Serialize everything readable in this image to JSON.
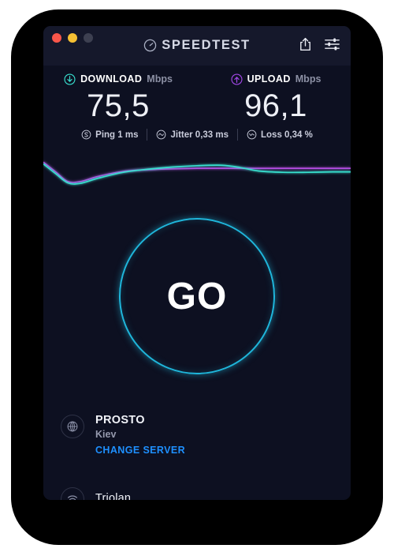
{
  "window": {
    "traffic_lights": [
      {
        "name": "close",
        "color": "#f9564a"
      },
      {
        "name": "minimize",
        "color": "#f5c033"
      },
      {
        "name": "zoom",
        "color": "#3d4051"
      }
    ],
    "brand": "SPEEDTEST",
    "brand_icon": "speedometer-icon",
    "actions": [
      {
        "name": "share-icon",
        "label": "Share"
      },
      {
        "name": "settings-icon",
        "label": "Settings"
      }
    ]
  },
  "results": {
    "download": {
      "label": "DOWNLOAD",
      "unit": "Mbps",
      "value": "75,5",
      "icon": "download-arrow-icon",
      "color": "#38e0cf"
    },
    "upload": {
      "label": "UPLOAD",
      "unit": "Mbps",
      "value": "96,1",
      "icon": "upload-arrow-icon",
      "color": "#a348e8"
    },
    "stats": [
      {
        "icon": "ping-icon",
        "text": "Ping 1 ms"
      },
      {
        "icon": "jitter-icon",
        "text": "Jitter 0,33 ms"
      },
      {
        "icon": "loss-icon",
        "text": "Loss 0,34 %"
      }
    ]
  },
  "chart_data": {
    "type": "line",
    "title": "",
    "xlabel": "",
    "ylabel": "",
    "grid": false,
    "legend": "none",
    "xlim": [
      0,
      100
    ],
    "ylim": [
      0,
      100
    ],
    "series": [
      {
        "name": "Download",
        "color": "#38e0cf",
        "x": [
          0,
          4,
          8,
          12,
          18,
          26,
          34,
          42,
          50,
          58,
          64,
          70,
          78,
          86,
          94,
          100
        ],
        "y": [
          74,
          52,
          31,
          30,
          42,
          55,
          62,
          67,
          70,
          71,
          66,
          58,
          55,
          55,
          56,
          56
        ]
      },
      {
        "name": "Upload",
        "color": "#b44be0",
        "x": [
          0,
          4,
          8,
          12,
          18,
          26,
          34,
          42,
          50,
          58,
          64,
          70,
          78,
          86,
          94,
          100
        ],
        "y": [
          78,
          56,
          34,
          34,
          46,
          57,
          61,
          63,
          64,
          64,
          64,
          64,
          64,
          64,
          64,
          64
        ]
      }
    ]
  },
  "go": {
    "label": "GO",
    "color": "#1fb6db"
  },
  "footer": {
    "server": {
      "icon": "globe-icon",
      "name": "PROSTO",
      "city": "Kiev",
      "change_label": "CHANGE SERVER",
      "change_color": "#1e90ff"
    },
    "isp": {
      "icon": "wifi-icon",
      "name": "Triolan"
    }
  }
}
